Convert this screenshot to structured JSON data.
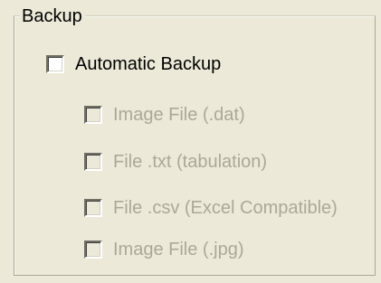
{
  "group": {
    "title": "Backup"
  },
  "automatic_backup": {
    "label": "Automatic Backup",
    "checked": false,
    "enabled": true
  },
  "options": [
    {
      "label": "Image File (.dat)",
      "checked": false,
      "enabled": false
    },
    {
      "label": "File .txt (tabulation)",
      "checked": false,
      "enabled": false
    },
    {
      "label": "File .csv (Excel Compatible)",
      "checked": false,
      "enabled": false
    },
    {
      "label": "Image File  (.jpg)",
      "checked": false,
      "enabled": false
    }
  ],
  "colors": {
    "background": "#ece9d8",
    "disabled_text": "#aca899",
    "enabled_text": "#000000"
  }
}
